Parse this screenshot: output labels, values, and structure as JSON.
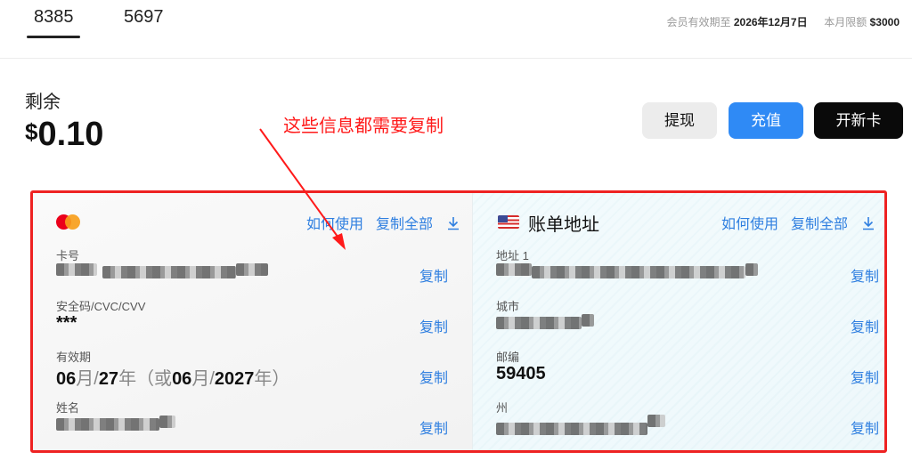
{
  "tabs": [
    {
      "label": "8385",
      "active": true
    },
    {
      "label": "5697",
      "active": false
    }
  ],
  "membership": {
    "expiry_label": "会员有效期至",
    "expiry_value": "2026年12月7日",
    "limit_label": "本月限额",
    "limit_value": "$3000"
  },
  "balance": {
    "label": "剩余",
    "currency": "$",
    "amount": "0.10"
  },
  "actions": {
    "withdraw": "提现",
    "recharge": "充值",
    "new_card": "开新卡"
  },
  "annotation": {
    "text": "这些信息都需要复制",
    "color": "#ff1a1a"
  },
  "card_panel": {
    "how_to_use": "如何使用",
    "copy_all": "复制全部",
    "copy_label": "复制",
    "fields": {
      "number": {
        "label": "卡号",
        "value_prefix": "5500",
        "value_suffix": "305"
      },
      "cvc": {
        "label": "安全码/CVC/CVV",
        "value": "***"
      },
      "expiry": {
        "label": "有效期",
        "month": "06",
        "month_unit": "月",
        "sep": "/",
        "year": "27",
        "year_unit": "年",
        "alt_open": "（或",
        "alt_month": "06",
        "alt_month_unit": "月",
        "alt_sep": "/",
        "alt_year": "2027",
        "alt_year_unit": "年",
        "alt_close": "）"
      },
      "name": {
        "label": "姓名",
        "value_suffix": "n"
      }
    }
  },
  "billing_panel": {
    "title": "账单地址",
    "how_to_use": "如何使用",
    "copy_all": "复制全部",
    "copy_label": "复制",
    "fields": {
      "address": {
        "label": "地址 1",
        "value_prefix": "115",
        "value_suffix": "t"
      },
      "city": {
        "label": "城市",
        "value_suffix": "k"
      },
      "zip": {
        "label": "邮编",
        "value": "59405"
      },
      "state": {
        "label": "州",
        "value_suffix": "州"
      }
    }
  },
  "colors": {
    "accent_blue": "#2f8af5",
    "link_blue": "#2f7fe0",
    "highlight_red": "#ee2222"
  }
}
